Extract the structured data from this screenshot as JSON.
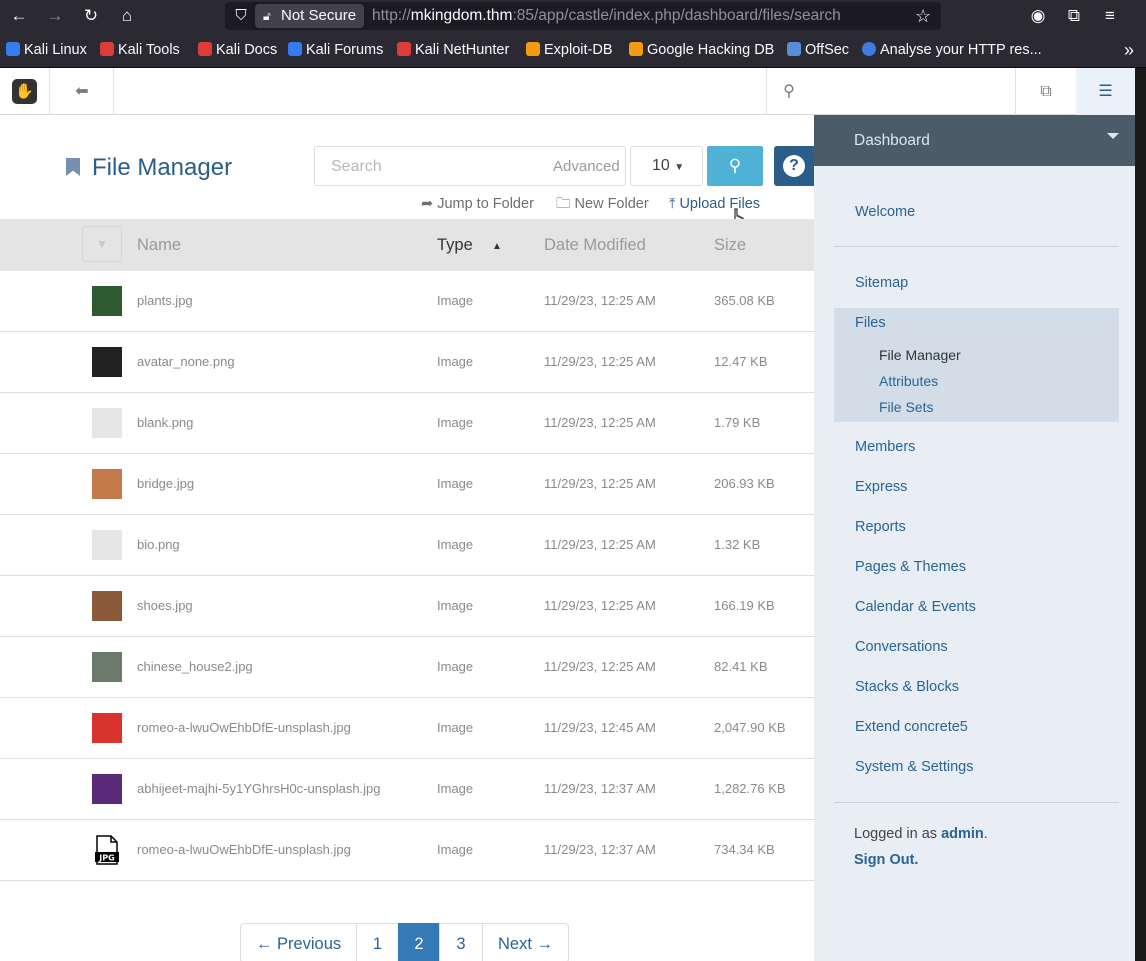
{
  "browser": {
    "security_label": "Not Secure",
    "url_prefix": "http://",
    "url_host": "mkingdom.thm",
    "url_rest": ":85/app/castle/index.php/dashboard/files/search"
  },
  "bookmarks": [
    {
      "label": "Kali Linux",
      "color": "#367bf0"
    },
    {
      "label": "Kali Tools",
      "color": "#e03b3b"
    },
    {
      "label": "Kali Docs",
      "color": "#e03b3b"
    },
    {
      "label": "Kali Forums",
      "color": "#367bf0"
    },
    {
      "label": "Kali NetHunter",
      "color": "#e03b3b"
    },
    {
      "label": "Exploit-DB",
      "color": "#f39c12"
    },
    {
      "label": "Google Hacking DB",
      "color": "#f39c12"
    },
    {
      "label": "OffSec",
      "color": "#5a8bd6"
    },
    {
      "label": "Analyse your HTTP res...",
      "color": "#3f7be0"
    }
  ],
  "header": {
    "title": "File Manager",
    "search_placeholder": "Search",
    "advanced_label": "Advanced",
    "per_page": "10",
    "help_label": "?",
    "actions": {
      "jump": "Jump to Folder",
      "new_folder": "New Folder",
      "upload": "Upload Files"
    }
  },
  "table": {
    "columns": [
      "Name",
      "Type",
      "Date Modified",
      "Size"
    ],
    "sorted_column": "Type",
    "rows": [
      {
        "name": "plants.jpg",
        "type": "Image",
        "date": "11/29/23, 12:25 AM",
        "size": "365.08 KB",
        "thumb": "#2d5a2e"
      },
      {
        "name": "avatar_none.png",
        "type": "Image",
        "date": "11/29/23, 12:25 AM",
        "size": "12.47 KB",
        "thumb": "#222222"
      },
      {
        "name": "blank.png",
        "type": "Image",
        "date": "11/29/23, 12:25 AM",
        "size": "1.79 KB",
        "thumb": "#e6e6e6"
      },
      {
        "name": "bridge.jpg",
        "type": "Image",
        "date": "11/29/23, 12:25 AM",
        "size": "206.93 KB",
        "thumb": "#c47a4a"
      },
      {
        "name": "bio.png",
        "type": "Image",
        "date": "11/29/23, 12:25 AM",
        "size": "1.32 KB",
        "thumb": "#e6e6e6"
      },
      {
        "name": "shoes.jpg",
        "type": "Image",
        "date": "11/29/23, 12:25 AM",
        "size": "166.19 KB",
        "thumb": "#8a5a3a"
      },
      {
        "name": "chinese_house2.jpg",
        "type": "Image",
        "date": "11/29/23, 12:25 AM",
        "size": "82.41 KB",
        "thumb": "#6b7a6b"
      },
      {
        "name": "romeo-a-lwuOwEhbDfE-unsplash.jpg",
        "type": "Image",
        "date": "11/29/23, 12:45 AM",
        "size": "2,047.90 KB",
        "thumb": "#d9332e"
      },
      {
        "name": "abhijeet-majhi-5y1YGhrsH0c-unsplash.jpg",
        "type": "Image",
        "date": "11/29/23, 12:37 AM",
        "size": "1,282.76 KB",
        "thumb": "#5a2a7a"
      },
      {
        "name": "romeo-a-lwuOwEhbDfE-unsplash.jpg",
        "type": "Image",
        "date": "11/29/23, 12:37 AM",
        "size": "734.34 KB",
        "thumb": "jpg-file-icon"
      }
    ]
  },
  "pagination": {
    "previous": "← Previous",
    "pages": [
      "1",
      "2",
      "3"
    ],
    "current": "2",
    "next": "Next →"
  },
  "sidebar": {
    "header": "Dashboard",
    "welcome": "Welcome",
    "items": [
      "Sitemap",
      "Files",
      "Members",
      "Express",
      "Reports",
      "Pages & Themes",
      "Calendar & Events",
      "Conversations",
      "Stacks & Blocks",
      "Extend concrete5",
      "System & Settings"
    ],
    "files_sub": [
      "File Manager",
      "Attributes",
      "File Sets"
    ],
    "current_sub": "File Manager",
    "logged_in_prefix": "Logged in as ",
    "user": "admin",
    "logged_in_suffix": ".",
    "sign_out": "Sign Out."
  }
}
